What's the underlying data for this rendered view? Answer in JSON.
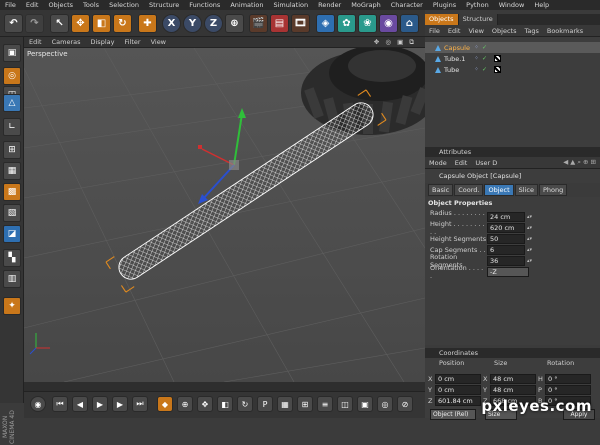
{
  "menubar": [
    "File",
    "Edit",
    "Objects",
    "Tools",
    "Selection",
    "Structure",
    "Functions",
    "Animation",
    "Simulation",
    "Render",
    "MoGraph",
    "Character",
    "Plugins",
    "Python",
    "Window",
    "Help"
  ],
  "toolbar": {
    "axis_x": "X",
    "axis_y": "Y",
    "axis_z": "Z"
  },
  "viewport": {
    "menu": [
      "Edit",
      "Cameras",
      "Display",
      "Filter",
      "View"
    ],
    "nav_icons": "✥ ◎ ▣ ⧉",
    "label": "Perspective"
  },
  "logo": "MAXON CINEMA 4D",
  "objects_panel": {
    "tabs": [
      "Objects",
      "Structure"
    ],
    "menu": [
      "File",
      "Edit",
      "View",
      "Objects",
      "Tags",
      "Bookmarks"
    ],
    "items": [
      {
        "name": "Capsule",
        "selected": true
      },
      {
        "name": "Tube.1",
        "selected": false
      },
      {
        "name": "Tube",
        "selected": false
      }
    ]
  },
  "attributes_panel": {
    "header": "Attributes",
    "menu": [
      "Mode",
      "Edit",
      "User D"
    ],
    "title": "Capsule Object [Capsule]",
    "tabs": [
      "Basic",
      "Coord.",
      "Object",
      "Slice",
      "Phong"
    ],
    "active_tab": "Object",
    "section": "Object Properties",
    "properties": [
      {
        "label": "Radius . . . . . . . . . .",
        "value": "24 cm"
      },
      {
        "label": "Height . . . . . . . . . .",
        "value": "620 cm"
      },
      {
        "label": "Height Segments",
        "value": "50"
      },
      {
        "label": "Cap Segments . .",
        "value": "6"
      },
      {
        "label": "Rotation Segments",
        "value": "36"
      },
      {
        "label": "Orientation . . . . .",
        "value": "-Z",
        "dropdown": true
      }
    ]
  },
  "coordinates_panel": {
    "header": "Coordinates",
    "columns": [
      "Position",
      "Size",
      "Rotation"
    ],
    "rows": [
      {
        "axis": "X",
        "pos": "0 cm",
        "size_axis": "X",
        "size": "48 cm",
        "rot_axis": "H",
        "rot": "0 °"
      },
      {
        "axis": "Y",
        "pos": "0 cm",
        "size_axis": "Y",
        "size": "48 cm",
        "rot_axis": "P",
        "rot": "0 °"
      },
      {
        "axis": "Z",
        "pos": "601.84 cm",
        "size_axis": "Z",
        "size": "668 cm",
        "rot_axis": "B",
        "rot": "0 °"
      }
    ],
    "mode_select": "Object (Rel)",
    "size_select": "Size",
    "apply_button": "Apply"
  },
  "watermark": "pxleyes.com",
  "colors": {
    "accent_orange": "#c9771a",
    "accent_blue": "#3a78b5",
    "axis_green": "#2fbf3a",
    "axis_red": "#d03030",
    "axis_blue": "#2a4fd0"
  }
}
